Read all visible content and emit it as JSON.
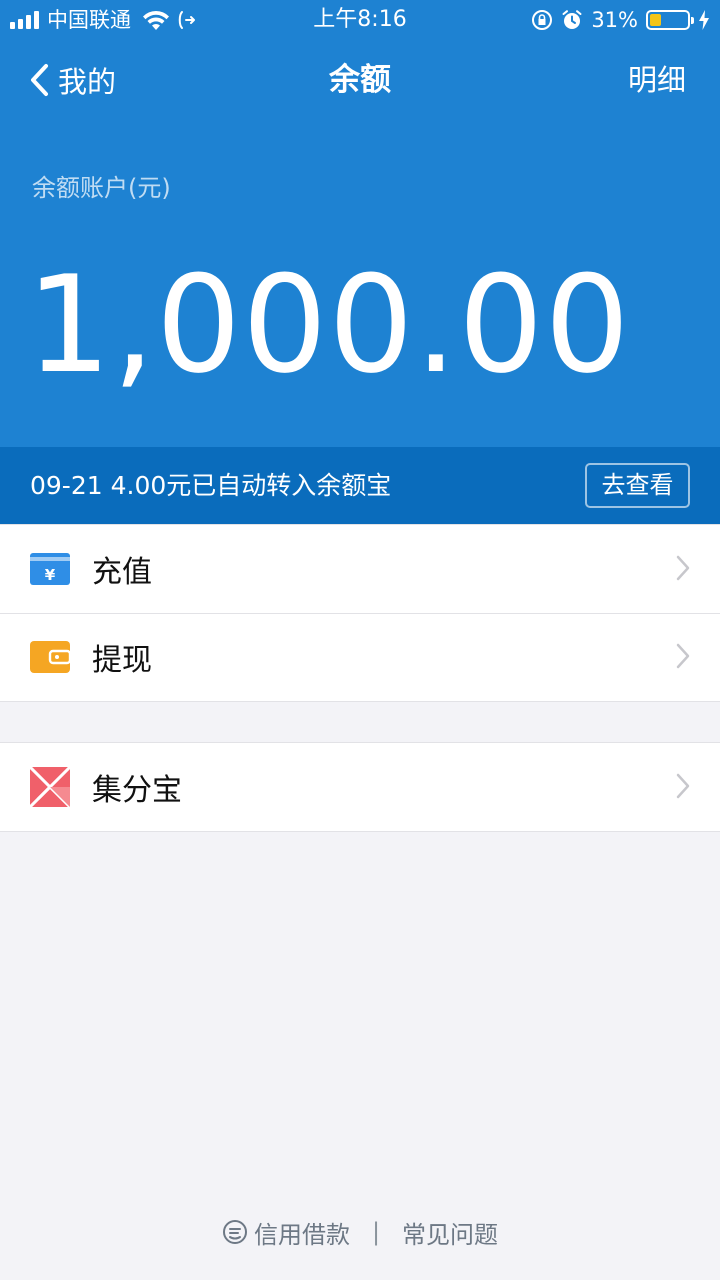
{
  "status_bar": {
    "carrier": "中国联通",
    "time": "上午8:16",
    "battery_pct": "31%",
    "battery_level": 0.31,
    "battery_color": "#f5c518"
  },
  "nav": {
    "back_label": "我的",
    "title": "余额",
    "right_label": "明细"
  },
  "account": {
    "label": "余额账户(元)",
    "amount": "1,000.00"
  },
  "notice": {
    "text": "09-21 4.00元已自动转入余额宝",
    "button": "去查看"
  },
  "menu_group_1": [
    {
      "label": "充值",
      "icon": "recharge-icon",
      "color": "#2f8ee6"
    },
    {
      "label": "提现",
      "icon": "withdraw-wallet-icon",
      "color": "#f5a623"
    }
  ],
  "menu_group_2": [
    {
      "label": "集分宝",
      "icon": "jifenbao-icon",
      "color": "#f0606a"
    }
  ],
  "footer": {
    "link1": "信用借款",
    "separator": "|",
    "link2": "常见问题"
  },
  "colors": {
    "primary_blue": "#1e82d2",
    "notice_blue": "#0a6cbc",
    "background": "#f3f3f7"
  }
}
